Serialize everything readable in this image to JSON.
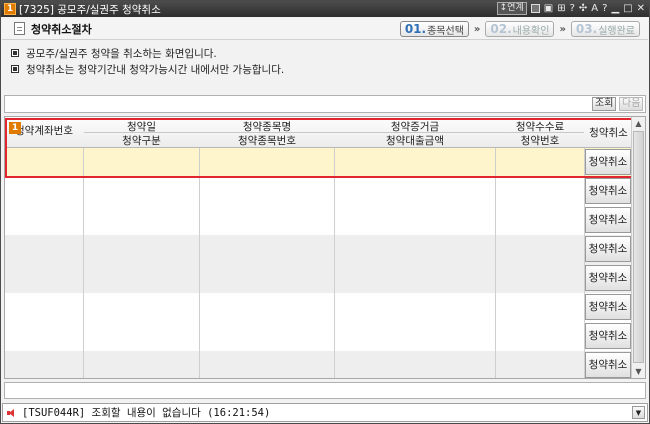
{
  "window": {
    "badge": "1",
    "title": "[7325] 공모주/실권주 청약취소",
    "controls": [
      "↕연계",
      "▪",
      "🔒",
      "⊞",
      "?",
      "📌",
      "A",
      "?",
      "_",
      "□",
      "×"
    ]
  },
  "header": {
    "title": "청약취소절차",
    "steps": [
      {
        "num": "01.",
        "label": "종목선택",
        "active": true
      },
      {
        "num": "02.",
        "label": "내용확인",
        "active": false
      },
      {
        "num": "03.",
        "label": "실행완료",
        "active": false
      }
    ],
    "arrow": "»"
  },
  "info": {
    "lines": [
      "공모주/실권주 청약을 취소하는 화면입니다.",
      "청약취소는 청약기간내 청약가능시간 내에서만 가능합니다."
    ]
  },
  "toolbar": {
    "query_label": "조회",
    "next_label": "다음"
  },
  "grid": {
    "badge": "1",
    "columns": [
      {
        "line1": "청약계좌번호",
        "line2": ""
      },
      {
        "line1": "청약일",
        "line2": "청약구분"
      },
      {
        "line1": "청약종목명",
        "line2": "청약종목번호"
      },
      {
        "line1": "청약증거금",
        "line2": "청약대출금액"
      },
      {
        "line1": "청약수수료",
        "line2": "청약번호"
      },
      {
        "line1": "청약취소",
        "line2": ""
      }
    ],
    "cancel_label": "청약취소",
    "row_count": 8
  },
  "status": {
    "message": "[TSUF044R] 조회할 내용이 없습니다 (16:21:54)"
  },
  "colors": {
    "highlight_border": "#e0262e",
    "selected_row": "#fff5cc",
    "active_step": "#2f6fb5",
    "badge": "#e07b00"
  }
}
